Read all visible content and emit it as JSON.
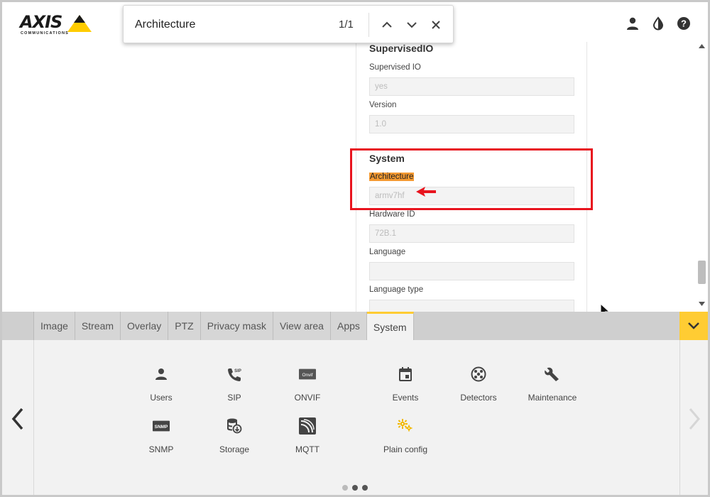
{
  "brand": {
    "name": "AXIS",
    "tagline": "COMMUNICATIONS"
  },
  "find_bar": {
    "query": "Architecture",
    "count": "1/1"
  },
  "panel": {
    "sections": [
      {
        "title": "SupervisedIO",
        "fields": [
          {
            "label": "Supervised IO",
            "value": "yes"
          },
          {
            "label": "Version",
            "value": "1.0"
          }
        ]
      },
      {
        "title": "System",
        "fields": [
          {
            "label": "Architecture",
            "value": "armv7hf"
          },
          {
            "label": "Hardware ID",
            "value": "72B.1"
          },
          {
            "label": "Language",
            "value": ""
          },
          {
            "label": "Language type",
            "value": ""
          }
        ]
      }
    ]
  },
  "tabs": [
    {
      "label": "Image"
    },
    {
      "label": "Stream"
    },
    {
      "label": "Overlay"
    },
    {
      "label": "PTZ"
    },
    {
      "label": "Privacy mask"
    },
    {
      "label": "View area"
    },
    {
      "label": "Apps"
    },
    {
      "label": "System",
      "active": true
    }
  ],
  "apps": [
    {
      "label": "Users",
      "icon": "user-icon"
    },
    {
      "label": "SIP",
      "icon": "phone-sip-icon"
    },
    {
      "label": "ONVIF",
      "icon": "onvif-icon"
    },
    {
      "label": "Events",
      "icon": "calendar-icon"
    },
    {
      "label": "Detectors",
      "icon": "detector-icon"
    },
    {
      "label": "Maintenance",
      "icon": "wrench-icon"
    },
    {
      "label": "SNMP",
      "icon": "snmp-icon"
    },
    {
      "label": "Storage",
      "icon": "storage-icon"
    },
    {
      "label": "MQTT",
      "icon": "mqtt-icon"
    },
    {
      "label": "Plain config",
      "icon": "plain-config-icon"
    }
  ],
  "onvif_icon_text": "Onvif",
  "snmp_icon_text": "SNMP",
  "sip_icon_text": "SIP",
  "pagination": {
    "active_page": 2,
    "pages": 3
  },
  "colors": {
    "accent": "#ffcc33",
    "highlight": "#f59a32",
    "annotation": "#e8141e",
    "plain_config_icon": "#f2b800"
  }
}
